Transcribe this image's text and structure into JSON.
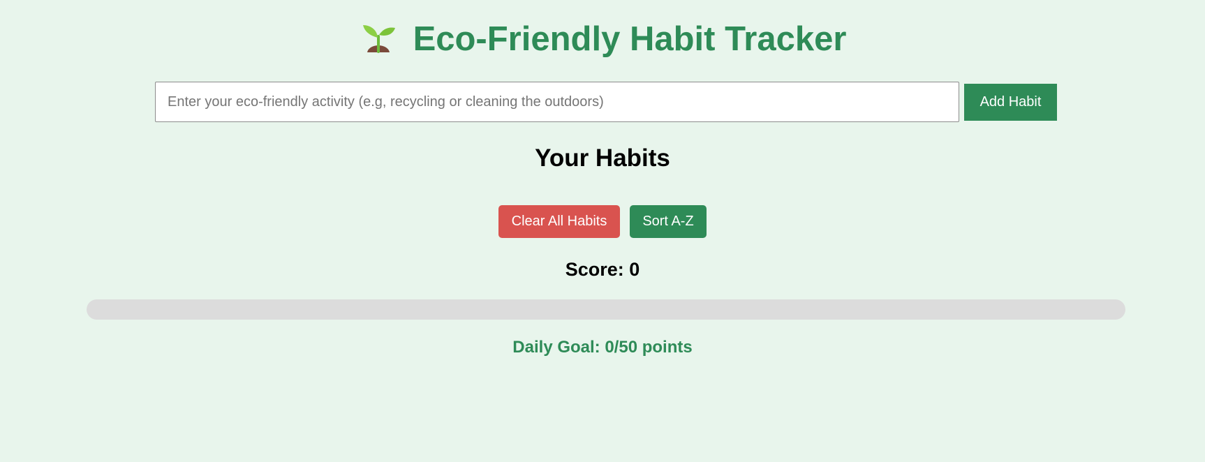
{
  "header": {
    "icon": "seedling-icon",
    "title": "Eco-Friendly Habit Tracker"
  },
  "habit_form": {
    "input_value": "",
    "input_placeholder": "Enter your eco-friendly activity (e.g, recycling or cleaning the outdoors)",
    "add_label": "Add Habit"
  },
  "habits": {
    "title": "Your Habits",
    "items": []
  },
  "actions": {
    "clear_label": "Clear All Habits",
    "sort_label": "Sort A-Z"
  },
  "score": {
    "text": "Score: 0",
    "progress_fraction": 0
  },
  "goal": {
    "text": "Daily Goal: 0/50 points"
  },
  "colors": {
    "background": "#e8f5ec",
    "accent": "#2e8b57",
    "danger": "#d9534f",
    "track": "#dcdcdc"
  }
}
